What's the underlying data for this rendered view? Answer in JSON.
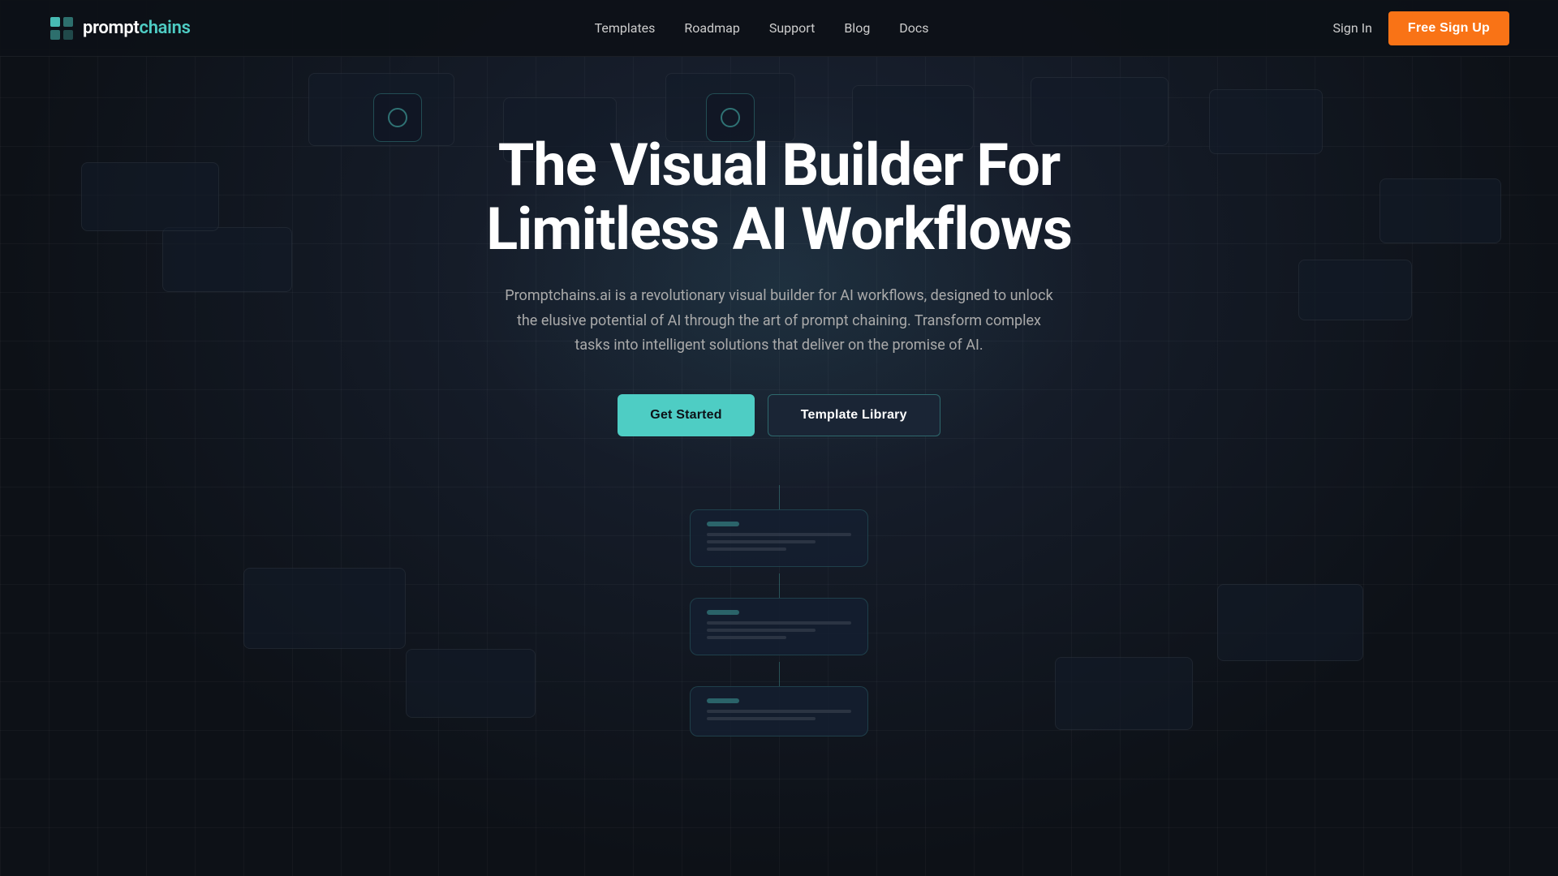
{
  "nav": {
    "logo_text_prompt": "prompt",
    "logo_text_chains": "chains",
    "links": [
      {
        "label": "Templates",
        "href": "#"
      },
      {
        "label": "Roadmap",
        "href": "#"
      },
      {
        "label": "Support",
        "href": "#"
      },
      {
        "label": "Blog",
        "href": "#"
      },
      {
        "label": "Docs",
        "href": "#"
      }
    ],
    "sign_in_label": "Sign In",
    "free_signup_label": "Free Sign Up"
  },
  "hero": {
    "title_line1": "The Visual Builder For",
    "title_line2": "Limitless AI Workflows",
    "subtitle": "Promptchains.ai is a revolutionary visual builder for AI workflows, designed to unlock the elusive potential of AI through the art of prompt chaining. Transform complex tasks into intelligent solutions that deliver on the promise of AI.",
    "btn_get_started": "Get Started",
    "btn_template_library": "Template Library"
  },
  "colors": {
    "accent": "#4ecdc4",
    "orange": "#f97316",
    "bg": "#0d1117",
    "nav_bg": "rgba(13,17,23,0.95)"
  }
}
